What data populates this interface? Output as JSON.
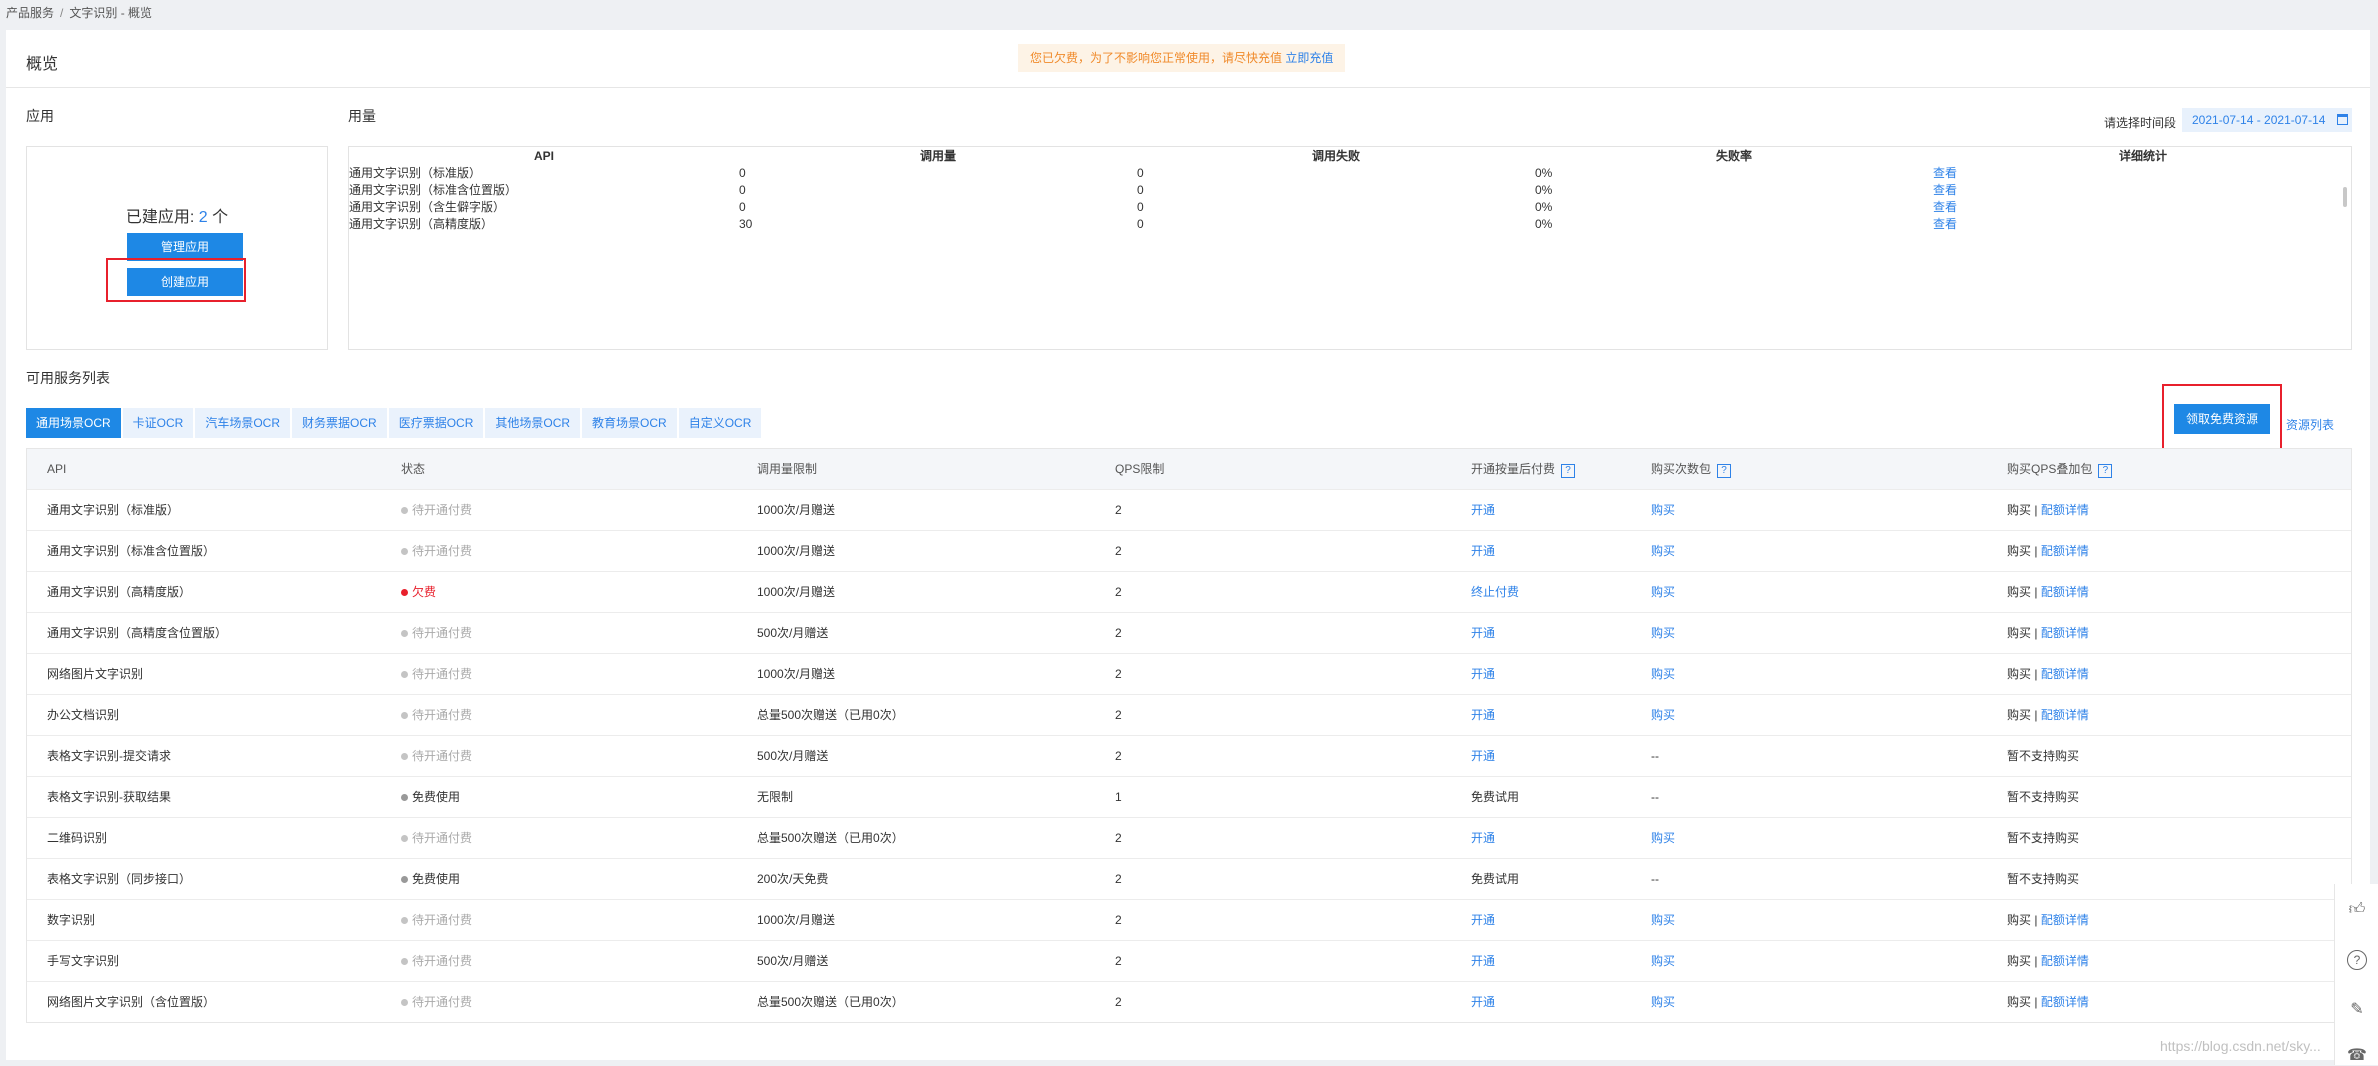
{
  "breadcrumb": {
    "root": "产品服务",
    "sep": "/",
    "current": "文字识别 - 概览"
  },
  "header": {
    "title": "概览",
    "notice_text": "您已欠费，为了不影响您正常使用，请尽快充值",
    "notice_link": "立即充值"
  },
  "apps": {
    "section_label": "应用",
    "count_label": "已建应用: ",
    "count": "2",
    "count_unit": " 个",
    "manage_btn": "管理应用",
    "create_btn": "创建应用"
  },
  "usage": {
    "section_label": "用量",
    "date_label": "请选择时间段",
    "date_range": "2021-07-14 - 2021-07-14",
    "columns": [
      "API",
      "调用量",
      "调用失败",
      "失败率",
      "详细统计"
    ],
    "rows": [
      {
        "api": "通用文字识别（标准版）",
        "calls": "0",
        "fails": "0",
        "rate": "0%",
        "link": "查看"
      },
      {
        "api": "通用文字识别（标准含位置版）",
        "calls": "0",
        "fails": "0",
        "rate": "0%",
        "link": "查看"
      },
      {
        "api": "通用文字识别（含生僻字版）",
        "calls": "0",
        "fails": "0",
        "rate": "0%",
        "link": "查看"
      },
      {
        "api": "通用文字识别（高精度版）",
        "calls": "30",
        "fails": "0",
        "rate": "0%",
        "link": "查看"
      }
    ]
  },
  "services": {
    "section_label": "可用服务列表",
    "tabs": [
      "通用场景OCR",
      "卡证OCR",
      "汽车场景OCR",
      "财务票据OCR",
      "医疗票据OCR",
      "其他场景OCR",
      "教育场景OCR",
      "自定义OCR"
    ],
    "free_btn": "领取免费资源",
    "resource_link": "资源列表",
    "columns": [
      "API",
      "状态",
      "调用量限制",
      "QPS限制",
      "开通按量后付费",
      "购买次数包",
      "购买QPS叠加包"
    ],
    "qmark": "?",
    "rows": [
      {
        "api": "通用文字识别（标准版）",
        "status": "待开通付费",
        "st": "grey",
        "limit": "1000次/月赠送",
        "qps": "2",
        "pay": "开通",
        "pay_link": true,
        "pack": "购买",
        "pack_link": true,
        "qps_buy": "购买",
        "qps_sep": " | ",
        "qps_detail": "配额详情"
      },
      {
        "api": "通用文字识别（标准含位置版）",
        "status": "待开通付费",
        "st": "grey",
        "limit": "1000次/月赠送",
        "qps": "2",
        "pay": "开通",
        "pay_link": true,
        "pack": "购买",
        "pack_link": true,
        "qps_buy": "购买",
        "qps_sep": " | ",
        "qps_detail": "配额详情"
      },
      {
        "api": "通用文字识别（高精度版）",
        "status": "欠费",
        "st": "red",
        "limit": "1000次/月赠送",
        "qps": "2",
        "pay": "终止付费",
        "pay_link": true,
        "pack": "购买",
        "pack_link": true,
        "qps_buy": "购买",
        "qps_sep": " | ",
        "qps_detail": "配额详情"
      },
      {
        "api": "通用文字识别（高精度含位置版）",
        "status": "待开通付费",
        "st": "grey",
        "limit": "500次/月赠送",
        "qps": "2",
        "pay": "开通",
        "pay_link": true,
        "pack": "购买",
        "pack_link": true,
        "qps_buy": "购买",
        "qps_sep": " | ",
        "qps_detail": "配额详情"
      },
      {
        "api": "网络图片文字识别",
        "status": "待开通付费",
        "st": "grey",
        "limit": "1000次/月赠送",
        "qps": "2",
        "pay": "开通",
        "pay_link": true,
        "pack": "购买",
        "pack_link": true,
        "qps_buy": "购买",
        "qps_sep": " | ",
        "qps_detail": "配额详情"
      },
      {
        "api": "办公文档识别",
        "status": "待开通付费",
        "st": "grey",
        "limit": "总量500次赠送（已用0次）",
        "qps": "2",
        "pay": "开通",
        "pay_link": true,
        "pack": "购买",
        "pack_link": true,
        "qps_buy": "购买",
        "qps_sep": " | ",
        "qps_detail": "配额详情"
      },
      {
        "api": "表格文字识别-提交请求",
        "status": "待开通付费",
        "st": "grey",
        "limit": "500次/月赠送",
        "qps": "2",
        "pay": "开通",
        "pay_link": true,
        "pack": "--",
        "pack_link": false,
        "qps_buy": "暂不支持购买",
        "qps_sep": "",
        "qps_detail": ""
      },
      {
        "api": "表格文字识别-获取结果",
        "status": "免费使用",
        "st": "dark",
        "limit": "无限制",
        "qps": "1",
        "pay": "免费试用",
        "pay_link": false,
        "pack": "--",
        "pack_link": false,
        "qps_buy": "暂不支持购买",
        "qps_sep": "",
        "qps_detail": ""
      },
      {
        "api": "二维码识别",
        "status": "待开通付费",
        "st": "grey",
        "limit": "总量500次赠送（已用0次）",
        "qps": "2",
        "pay": "开通",
        "pay_link": true,
        "pack": "购买",
        "pack_link": true,
        "qps_buy": "暂不支持购买",
        "qps_sep": "",
        "qps_detail": ""
      },
      {
        "api": "表格文字识别（同步接口）",
        "status": "免费使用",
        "st": "dark",
        "limit": "200次/天免费",
        "qps": "2",
        "pay": "免费试用",
        "pay_link": false,
        "pack": "--",
        "pack_link": false,
        "qps_buy": "暂不支持购买",
        "qps_sep": "",
        "qps_detail": ""
      },
      {
        "api": "数字识别",
        "status": "待开通付费",
        "st": "grey",
        "limit": "1000次/月赠送",
        "qps": "2",
        "pay": "开通",
        "pay_link": true,
        "pack": "购买",
        "pack_link": true,
        "qps_buy": "购买",
        "qps_sep": " | ",
        "qps_detail": "配额详情"
      },
      {
        "api": "手写文字识别",
        "status": "待开通付费",
        "st": "grey",
        "limit": "500次/月赠送",
        "qps": "2",
        "pay": "开通",
        "pay_link": true,
        "pack": "购买",
        "pack_link": true,
        "qps_buy": "购买",
        "qps_sep": " | ",
        "qps_detail": "配额详情"
      },
      {
        "api": "网络图片文字识别（含位置版）",
        "status": "待开通付费",
        "st": "grey",
        "limit": "总量500次赠送（已用0次）",
        "qps": "2",
        "pay": "开通",
        "pay_link": true,
        "pack": "购买",
        "pack_link": true,
        "qps_buy": "购买",
        "qps_sep": " | ",
        "qps_detail": "配额详情"
      }
    ]
  },
  "side_icons": [
    "thumbs-up-icon",
    "question-icon",
    "edit-icon",
    "headset-icon"
  ],
  "watermark": "https://blog.csdn.net/sky..."
}
